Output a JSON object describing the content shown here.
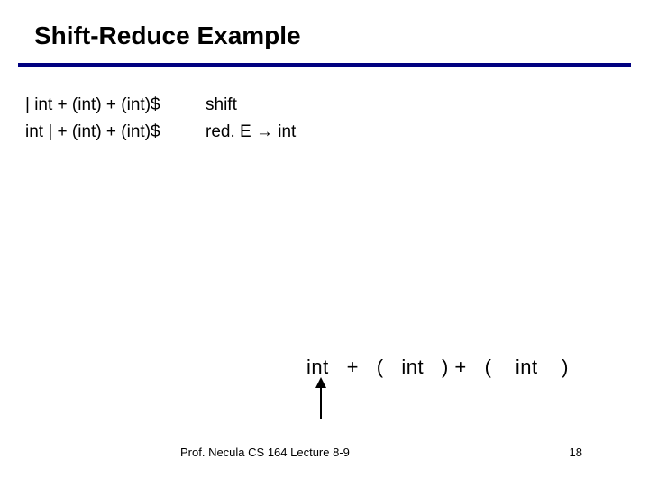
{
  "title": "Shift-Reduce Example",
  "steps": [
    {
      "stack": "| int + (int) + (int)$",
      "action": "shift"
    },
    {
      "stack": "int | + (int) + (int)$",
      "action": "red. E → int"
    }
  ],
  "tree": {
    "tokens": "int   +   (   int   ) +   (    int    )"
  },
  "footer": {
    "left": "Prof. Necula  CS 164  Lecture 8-9",
    "right": "18"
  }
}
